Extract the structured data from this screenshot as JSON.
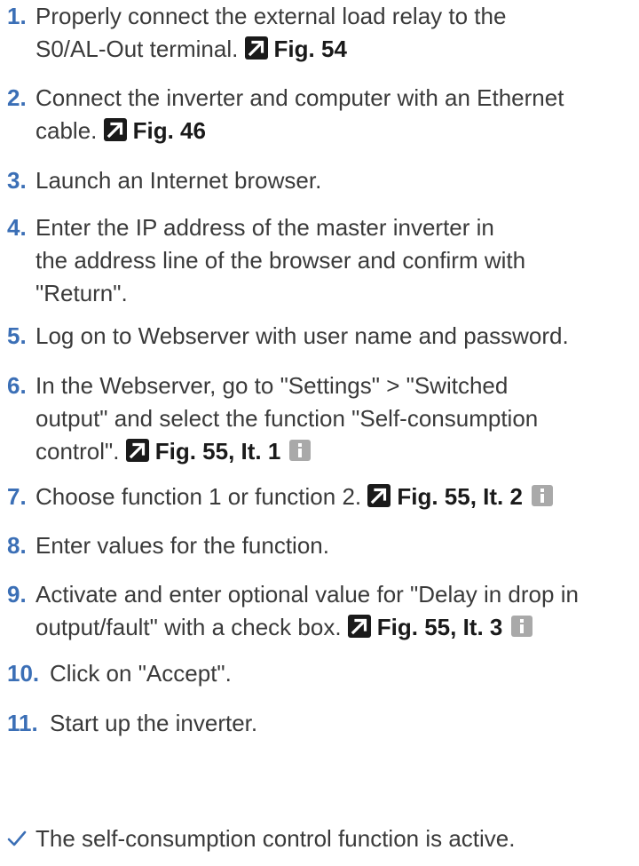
{
  "steps": [
    {
      "num": "1.",
      "lines": [
        "Properly connect the external load relay to the",
        "S0/AL-Out terminal."
      ],
      "ref": "Fig. 54",
      "info": false
    },
    {
      "num": "2.",
      "lines": [
        "Connect the inverter and computer with an Ethernet",
        "cable."
      ],
      "ref": "Fig. 46",
      "info": false
    },
    {
      "num": "3.",
      "lines": [
        "Launch an Internet browser."
      ],
      "ref": null,
      "info": false
    },
    {
      "num": "4.",
      "lines": [
        "Enter the IP address of the master inverter in",
        "the address line of the browser and confirm with",
        "\"Return\"."
      ],
      "ref": null,
      "info": false
    },
    {
      "num": "5.",
      "lines": [
        "Log on to Webserver with user name and password."
      ],
      "ref": null,
      "info": false
    },
    {
      "num": "6.",
      "lines": [
        "In the Webserver, go to \"Settings\" > \"Switched",
        "output\" and select the function \"Self-consumption",
        "control\"."
      ],
      "ref": "Fig. 55, It. 1",
      "info": true
    },
    {
      "num": "7.",
      "lines": [
        "Choose function 1 or function 2."
      ],
      "ref": "Fig. 55, It. 2",
      "info": true
    },
    {
      "num": "8.",
      "lines": [
        "Enter values for the function."
      ],
      "ref": null,
      "info": false
    },
    {
      "num": "9.",
      "lines": [
        "Activate and enter optional value for \"Delay in drop in",
        "output/fault\" with a check box."
      ],
      "ref": "Fig. 55, It. 3",
      "info": true
    },
    {
      "num": "10.",
      "lines": [
        "Click on \"Accept\"."
      ],
      "ref": null,
      "info": false
    },
    {
      "num": "11.",
      "lines": [
        "Start up the inverter."
      ],
      "ref": null,
      "info": false
    }
  ],
  "result": {
    "icon": "checkmark-icon",
    "text": "The self-consumption control function is active."
  },
  "icons": {
    "reference": "cross-reference-arrow-icon",
    "info": "info-icon"
  },
  "colors": {
    "step_number": "#3b6fb6",
    "body_text": "#3a3a3a",
    "reference_text": "#1a1a1a",
    "info_icon_bg": "#a9a9a9",
    "check_color": "#3b6fb6"
  }
}
